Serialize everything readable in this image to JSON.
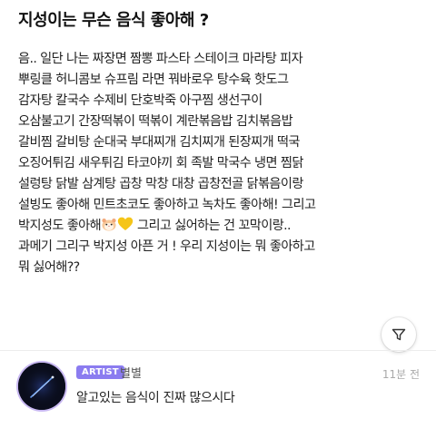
{
  "post": {
    "title": "지성이는 무슨 음식 좋아해 ?",
    "lines": [
      "음.. 일단 나는 짜장면 짬뽕 파스타 스테이크 마라탕 피자",
      "뿌링클 허니콤보 슈프림 라면 꿔바로우 탕수육 핫도그",
      "감자탕 칼국수 수제비 단호박죽 아구찜 생선구이",
      "오삼불고기 간장떡볶이 떡볶이 계란볶음밥 김치볶음밥",
      "갈비찜 갈비탕 순대국 부대찌개 김치찌개 된장찌개 떡국",
      "오징어튀김 새우튀김 타코야끼 회 족발 막국수 냉면 찜닭",
      "설렁탕 닭발 삼계탕 곱창 막창 대창 곱창전골 닭볶음이랑",
      "설빙도 좋아해 민트초코도 좋아하고 녹차도 좋아해! 그리고"
    ],
    "line9_before": "박지성도 좋아해",
    "line9_after": " 그리고 싫어하는 건 꼬막이랑..",
    "lines_end": [
      "과메기 그리구 박지성 아픈 거 ! 우리 지성이는 뭐 좋아하고",
      "뭐 싫어해??"
    ],
    "emojis": [
      "hamster-icon",
      "yellow-heart-icon"
    ]
  },
  "filter": {
    "icon": "filter-icon"
  },
  "reply": {
    "badge": "ARTIST",
    "author": "별별",
    "time": "11분 전",
    "text": "알고있는 음식이 진짜 많으시다",
    "badge_color": "#8b7cf0"
  }
}
